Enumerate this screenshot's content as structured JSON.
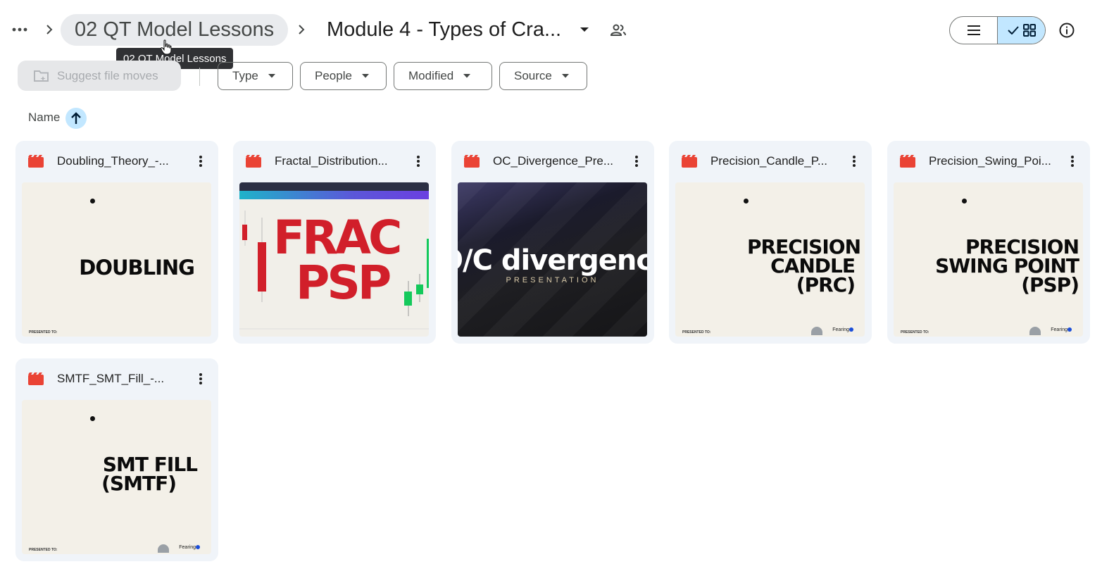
{
  "breadcrumb": {
    "parent": "02 QT Model Lessons",
    "current": "Module 4 - Types of Cra..."
  },
  "tooltip": "02 QT Model Lessons",
  "view": {
    "mode": "grid"
  },
  "toolbar": {
    "suggest_label": "Suggest file moves",
    "filters": [
      "Type",
      "People",
      "Modified",
      "Source"
    ]
  },
  "sort": {
    "label": "Name",
    "direction": "ascending"
  },
  "colors": {
    "accent": "#c2e7ff",
    "video_icon": "#ea4335",
    "card_bg": "#f0f4f9"
  },
  "files": [
    {
      "name": "Doubling_Theory_-...",
      "icon": "video-file-icon",
      "thumb_headline": "DOUBLING"
    },
    {
      "name": "Fractal_Distribution...",
      "icon": "video-file-icon",
      "thumb_headline_1": "FRAC",
      "thumb_headline_2": "PSP"
    },
    {
      "name": "OC_Divergence_Pre...",
      "icon": "video-file-icon",
      "thumb_headline": "O/C divergence",
      "thumb_sub": "PRESENTATION"
    },
    {
      "name": "Precision_Candle_P...",
      "icon": "video-file-icon",
      "thumb_line_1": "PRECISION",
      "thumb_line_2": "CANDLE",
      "thumb_line_3": "(PRC)"
    },
    {
      "name": "Precision_Swing_Poi...",
      "icon": "video-file-icon",
      "thumb_line_1": "PRECISION",
      "thumb_line_2": "SWING POINT",
      "thumb_line_3": "(PSP)"
    },
    {
      "name": "SMTF_SMT_Fill_-...",
      "icon": "video-file-icon",
      "thumb_line_1": "SMT FILL",
      "thumb_line_2": "(SMTF)"
    }
  ],
  "thumb_common": {
    "presented": "PRESENTED TO:",
    "brand": "Fearing"
  }
}
